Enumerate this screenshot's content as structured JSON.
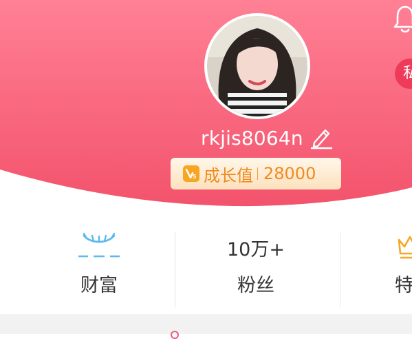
{
  "profile": {
    "username": "rkjis8064n",
    "growth": {
      "badge": "V5",
      "label": "成长值",
      "value": "28000"
    },
    "side_badge": "私"
  },
  "stats": [
    {
      "icon": "sleepy-eye-icon",
      "value": "",
      "label": "财富"
    },
    {
      "icon": "",
      "value": "10万+",
      "label": "粉丝"
    },
    {
      "icon": "crown-icon",
      "value": "",
      "label": "特"
    }
  ],
  "colors": {
    "header_top": "#ff7f94",
    "header_bottom": "#f4566d",
    "growth_text": "#f08a1e",
    "eye_icon": "#5bb9f0",
    "crown_icon": "#f5a623"
  }
}
